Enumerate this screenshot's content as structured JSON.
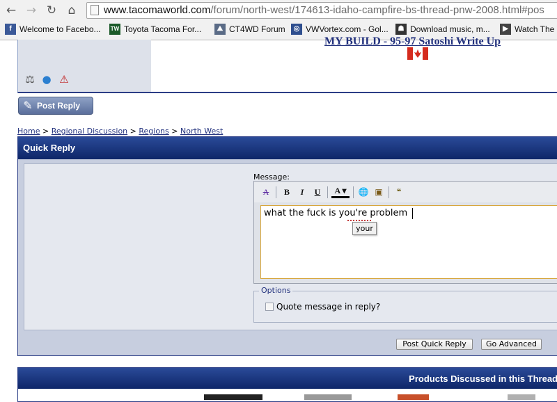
{
  "browser": {
    "url_host": "www.tacomaworld.com",
    "url_path": "/forum/north-west/174613-idaho-campfire-bs-thread-pnw-2008.html#pos",
    "bookmarks": [
      {
        "label": "Welcome to Facebo...",
        "icon": "facebook-icon",
        "color": "#3b5998",
        "glyph": "f"
      },
      {
        "label": "Toyota Tacoma For...",
        "icon": "tacomaworld-icon",
        "color": "#1c5b2a",
        "glyph": "TW"
      },
      {
        "label": "CT4WD Forum",
        "icon": "ct4wd-icon",
        "color": "#5a6b86",
        "glyph": "⛰"
      },
      {
        "label": "VWVortex.com - Gol...",
        "icon": "vwvortex-icon",
        "color": "#2f4f8f",
        "glyph": "◎"
      },
      {
        "label": "Download music, m...",
        "icon": "download-icon",
        "color": "#333333",
        "glyph": "☗"
      },
      {
        "label": "Watch The V",
        "icon": "video-icon",
        "color": "#444444",
        "glyph": "▶"
      }
    ]
  },
  "post": {
    "sig_link1": "MY BUILD",
    "sig_sep": " - ",
    "sig_link2": "95-97 Satoshi Write Up"
  },
  "post_reply_label": "Post Reply",
  "breadcrumb": {
    "home": "Home",
    "regional": "Regional Discussion",
    "regions": "Regions",
    "current": "North West",
    "sep": " > "
  },
  "quick_reply": {
    "title": "Quick Reply",
    "message_label": "Message:",
    "message_text": "what the fuck is you're problem",
    "suggestion": "your",
    "options_legend": "Options",
    "quote_label": "Quote message in reply?",
    "post_button": "Post Quick Reply",
    "advanced_button": "Go Advanced"
  },
  "products": {
    "title": "Products Discussed in this Thread"
  },
  "colors": {
    "header_blue": "#0e2668",
    "link_blue": "#22317d",
    "panel_gray": "#dde1ea"
  }
}
